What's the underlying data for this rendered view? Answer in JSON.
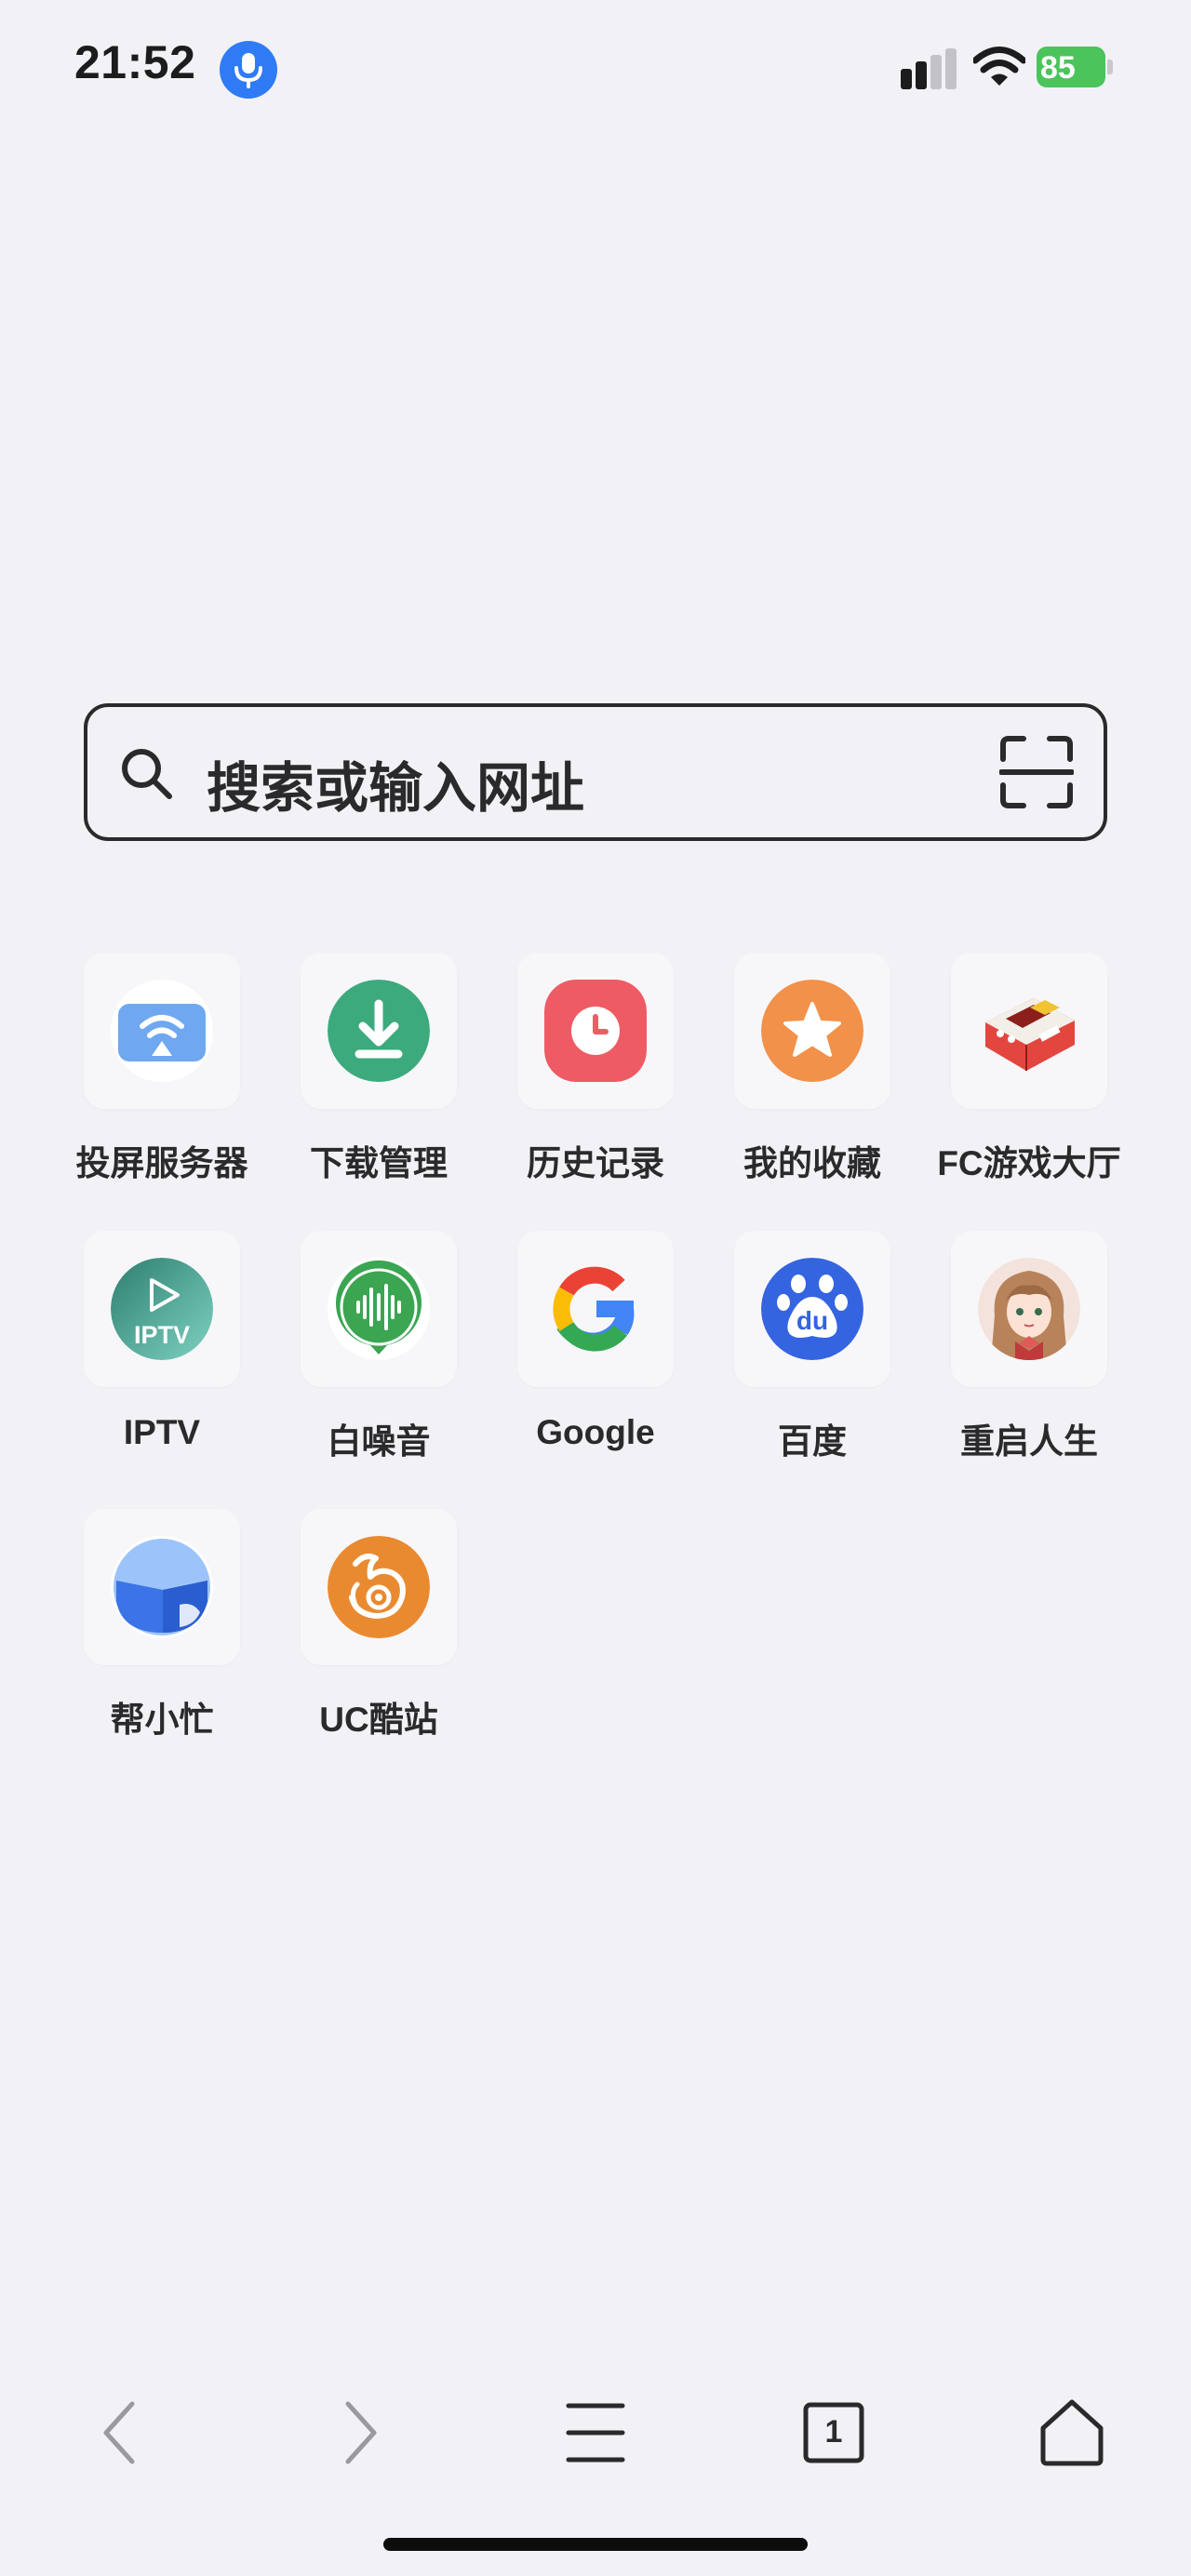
{
  "status_bar": {
    "time": "21:52",
    "battery": "85",
    "icons": [
      "microphone-icon",
      "cellular-signal-icon",
      "wifi-icon",
      "battery-charging-icon"
    ]
  },
  "search": {
    "placeholder": "搜索或输入网址",
    "icons": [
      "search-icon",
      "scan-icon"
    ]
  },
  "shortcuts": [
    {
      "label": "投屏服务器",
      "icon": "cast-icon",
      "color": "#6fa8f0"
    },
    {
      "label": "下载管理",
      "icon": "download-icon",
      "color": "#3daa7e"
    },
    {
      "label": "历史记录",
      "icon": "clock-icon",
      "color": "#ee5b64"
    },
    {
      "label": "我的收藏",
      "icon": "star-icon",
      "color": "#f2914a"
    },
    {
      "label": "FC游戏大厅",
      "icon": "game-console-icon",
      "color": "#e2463f"
    },
    {
      "label": "IPTV",
      "icon": "iptv-icon",
      "color": "#3c9a8a",
      "badge": "IPTV"
    },
    {
      "label": "白噪音",
      "icon": "sound-wave-icon",
      "color": "#3ba552"
    },
    {
      "label": "Google",
      "icon": "google-icon",
      "color": "#4285f4"
    },
    {
      "label": "百度",
      "icon": "baidu-paw-icon",
      "color": "#3464e0",
      "badge": "du"
    },
    {
      "label": "重启人生",
      "icon": "anime-avatar-icon",
      "color": "#b8835a"
    },
    {
      "label": "帮小忙",
      "icon": "helper-icon",
      "color": "#3a74e6"
    },
    {
      "label": "UC酷站",
      "icon": "uc-squirrel-icon",
      "color": "#ea8a30"
    }
  ],
  "toolbar": {
    "back": "back-icon",
    "forward": "forward-icon",
    "menu": "menu-icon",
    "tabs_count": "1",
    "home": "home-icon"
  }
}
